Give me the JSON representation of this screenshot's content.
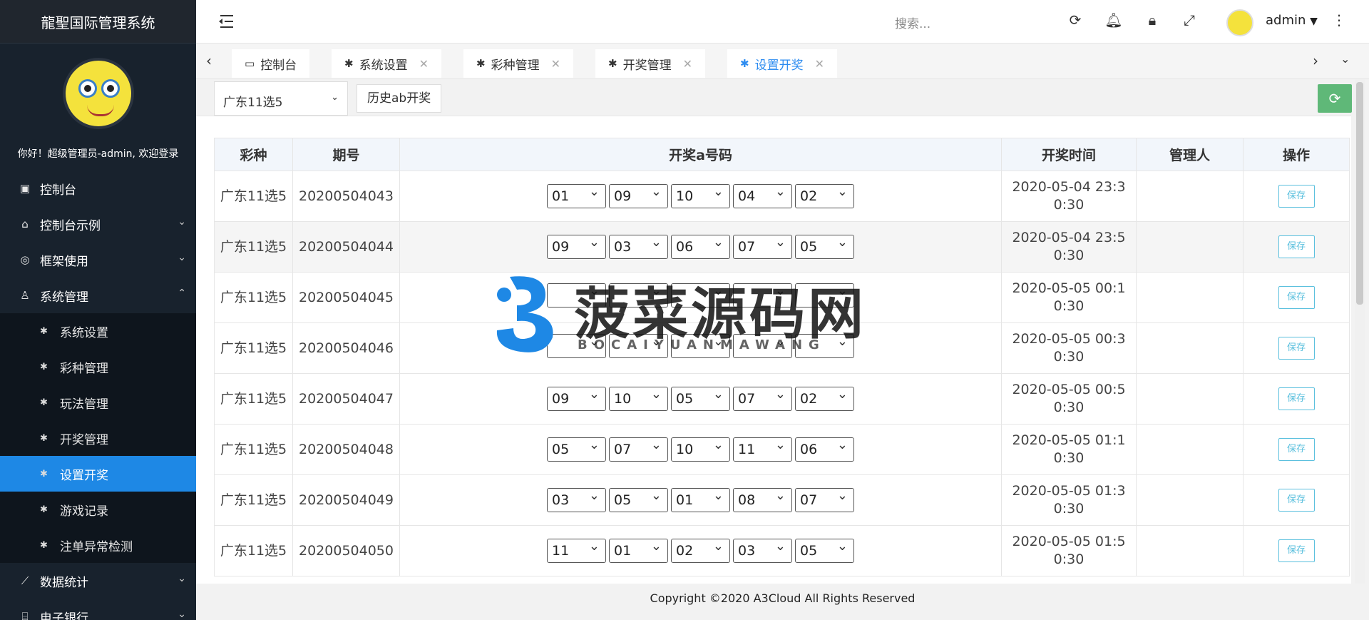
{
  "sidebar": {
    "brand": "龍聖国际管理系统",
    "greeting": "你好！超级管理员-admin, 欢迎登录",
    "menu": [
      {
        "label": "控制台",
        "icon": "dashboard-icon"
      },
      {
        "label": "控制台示例",
        "icon": "home-icon"
      },
      {
        "label": "框架使用",
        "icon": "ok-icon"
      },
      {
        "label": "系统管理",
        "icon": "user-icon"
      }
    ],
    "submenu": [
      {
        "label": "系统设置"
      },
      {
        "label": "彩种管理"
      },
      {
        "label": "玩法管理"
      },
      {
        "label": "开奖管理"
      },
      {
        "label": "设置开奖",
        "active": true
      },
      {
        "label": "游戏记录"
      },
      {
        "label": "注单异常检测"
      }
    ],
    "menu_after": [
      {
        "label": "数据统计",
        "icon": "chart-icon"
      },
      {
        "label": "电子银行",
        "icon": "bank-icon"
      }
    ]
  },
  "header": {
    "search_placeholder": "搜索...",
    "username": "admin"
  },
  "tabs": [
    {
      "label": "控制台",
      "closable": false
    },
    {
      "label": "系统设置",
      "closable": true
    },
    {
      "label": "彩种管理",
      "closable": true
    },
    {
      "label": "开奖管理",
      "closable": true
    },
    {
      "label": "设置开奖",
      "closable": true,
      "active": true
    }
  ],
  "toolbar": {
    "lottery_select": "广东11选5",
    "history_button": "历史ab开奖"
  },
  "table": {
    "headers": [
      "彩种",
      "期号",
      "开奖a号码",
      "开奖时间",
      "管理人",
      "操作"
    ],
    "save_label": "保存",
    "rows": [
      {
        "lottery": "广东11选5",
        "issue": "20200504043",
        "numbers": [
          "01",
          "09",
          "10",
          "04",
          "02"
        ],
        "time": "2020-05-04 23:30:30",
        "manager": ""
      },
      {
        "lottery": "广东11选5",
        "issue": "20200504044",
        "numbers": [
          "09",
          "03",
          "06",
          "07",
          "05"
        ],
        "time": "2020-05-04 23:50:30",
        "manager": ""
      },
      {
        "lottery": "广东11选5",
        "issue": "20200504045",
        "numbers": [
          "",
          "",
          "",
          "",
          ""
        ],
        "time": "2020-05-05 00:10:30",
        "manager": ""
      },
      {
        "lottery": "广东11选5",
        "issue": "20200504046",
        "numbers": [
          "",
          "",
          "",
          "",
          ""
        ],
        "time": "2020-05-05 00:30:30",
        "manager": ""
      },
      {
        "lottery": "广东11选5",
        "issue": "20200504047",
        "numbers": [
          "09",
          "10",
          "05",
          "07",
          "02"
        ],
        "time": "2020-05-05 00:50:30",
        "manager": ""
      },
      {
        "lottery": "广东11选5",
        "issue": "20200504048",
        "numbers": [
          "05",
          "07",
          "10",
          "11",
          "06"
        ],
        "time": "2020-05-05 01:10:30",
        "manager": ""
      },
      {
        "lottery": "广东11选5",
        "issue": "20200504049",
        "numbers": [
          "03",
          "05",
          "01",
          "08",
          "07"
        ],
        "time": "2020-05-05 01:30:30",
        "manager": ""
      },
      {
        "lottery": "广东11选5",
        "issue": "20200504050",
        "numbers": [
          "11",
          "01",
          "02",
          "03",
          "05"
        ],
        "time": "2020-05-05 01:50:30",
        "manager": ""
      }
    ]
  },
  "footer": {
    "copyright": "Copyright ©2020 A3Cloud All Rights Reserved"
  },
  "watermark": {
    "text": "菠菜源码网",
    "subtext": "BOCAIYUANMAWANG"
  }
}
